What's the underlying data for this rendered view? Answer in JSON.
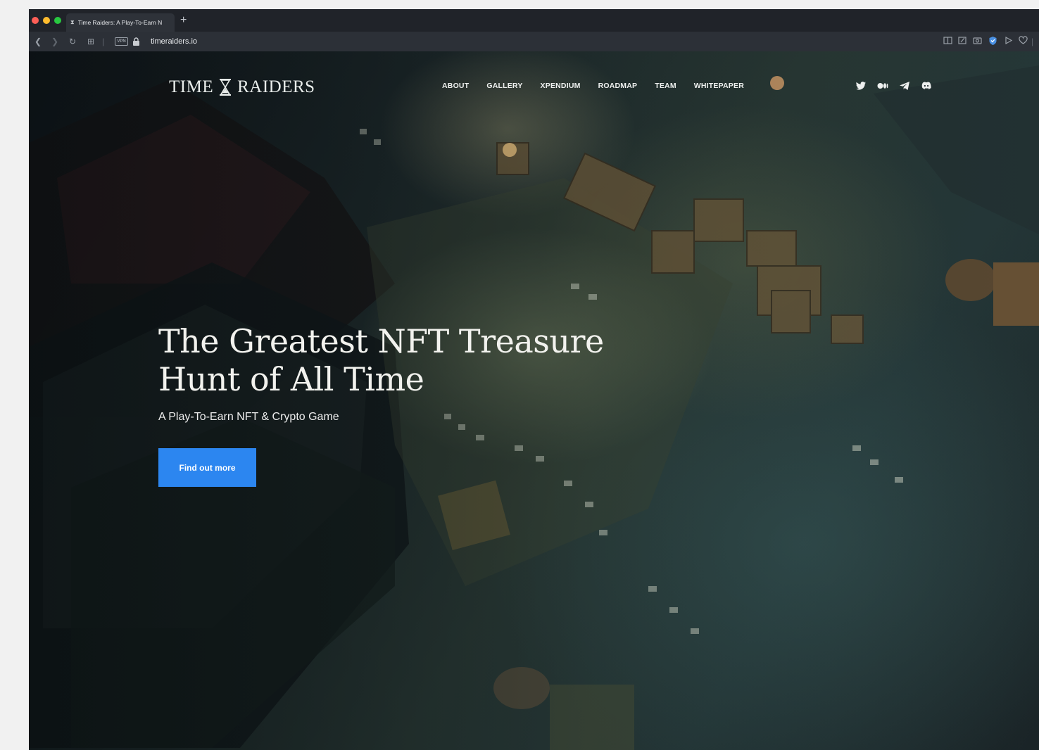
{
  "browser": {
    "tab": {
      "title": "Time Raiders: A Play-To-Earn N",
      "favicon": "hourglass-icon"
    },
    "new_tab_label": "+",
    "url": "timeraiders.io",
    "vpn_label": "VPN"
  },
  "site": {
    "logo_left": "TIME",
    "logo_right": "RAIDERS",
    "nav": [
      "ABOUT",
      "GALLERY",
      "XPENDIUM",
      "ROADMAP",
      "TEAM",
      "WHITEPAPER"
    ],
    "socials": [
      "twitter-icon",
      "medium-icon",
      "telegram-icon",
      "discord-icon"
    ]
  },
  "hero": {
    "title_line1": "The Greatest NFT Treasure",
    "title_line2": "Hunt of All Time",
    "subtitle": "A Play-To-Earn NFT & Crypto Game",
    "cta_label": "Find out more",
    "cta_color": "#2c86f0"
  }
}
